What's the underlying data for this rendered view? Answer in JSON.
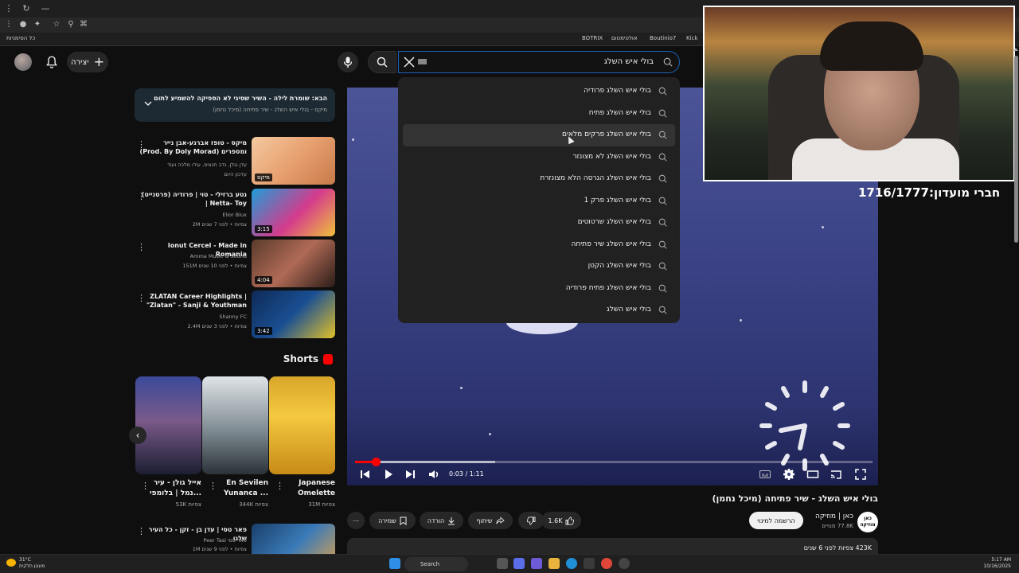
{
  "browser": {
    "bookmarks": [
      {
        "label": "Kick"
      },
      {
        "label": "Boutinio7"
      },
      {
        "label": "אולטימטום"
      },
      {
        "label": "BOTRIX"
      }
    ],
    "all_bookmarks": "כל הסימניות"
  },
  "header": {
    "create_label": "יצירה",
    "search_value": "בולי איש השלג"
  },
  "suggestions": [
    "בולי איש השלג פרודיה",
    "בולי איש השלג פתיח",
    "בולי איש השלג פרקים מלאים",
    "בולי איש השלג לא מצונזר",
    "בולי איש השלג הגרסה הלא מצונזרת",
    "בולי איש השלג פרק 1",
    "בולי איש השלג שרטוטים",
    "בולי איש השלג שיר פתיחה",
    "בולי איש השלג הקטן",
    "בולי איש השלג פתיח פרודיה",
    "בולי איש השלג"
  ],
  "player": {
    "time": "0:03 / 1:11",
    "progress_played": 0.04,
    "progress_buffered": 0.27
  },
  "video": {
    "title": "בולי איש השלג - שיר פתיחה (מיכל נחמן)",
    "channel": "כאן | מוזיקה",
    "subscribers": "77.8K מנויים",
    "channel_logo_text": "כאן מוזיקה",
    "subscribe": "הרשמה למינוי",
    "likes": "1.6K",
    "share": "שיתוף",
    "download": "הורדה",
    "save": "שמירה",
    "views_date": "423K צפיות לפני 6 שנים"
  },
  "overlay": {
    "members": "חברי מועדון:1716/1777"
  },
  "up_next": {
    "title": "הבא: שומרת לילה - השיר שסיגי לא הספיקה להשמיע לתום",
    "subtitle": "מיקס - בולי איש השלג - שיר פתיחה (מיכל נחמן)"
  },
  "recommendations": [
    {
      "title": "מיקס - טופז אברגע-אבן נייר (Prod. By Doly Morad) ומספרים",
      "meta1": "עדן גולן, נדב חנציס, עידו מלכה ועוד",
      "meta2": "עדכון היום",
      "badge": "מיקס"
    },
    {
      "title": "נטע ברזילי - טוי | פרודיה (פרטנייט) | Netta- Toy",
      "meta1": "Elior Blux",
      "meta2": "2M צפיות • לפני 7 שנים",
      "duration": "3:15"
    },
    {
      "title": "Ionut Cercel - Made in Romania",
      "meta1": "Amma Music & Sound",
      "meta2": "151M צפיות • לפני 10 שנים",
      "duration": "4:04"
    },
    {
      "title": "ZLATAN Career Highlights | \"Zlatan\" - Sanji & Youthman",
      "meta1": "Shanny FC",
      "meta2": "2.4M צפיות • לפני 3 שנים",
      "duration": "3:42"
    },
    {
      "title": "פאר טסי | עדן בן - זקן - כל העיר שלנו",
      "meta1": "Peer Tasi פאר טסי",
      "meta2": "1M צפיות • לפני 9 שנים"
    }
  ],
  "shorts": {
    "title": "Shorts",
    "items": [
      {
        "caption": "Japanese Omelette",
        "views": "31M צפיות"
      },
      {
        "caption": "En Sevilen Yunanca ...",
        "views": "344K צפיות"
      },
      {
        "caption": "אייל גולן - עיר נמל | בלומפי...",
        "views": "53K צפיות"
      }
    ]
  },
  "taskbar": {
    "temp": "31°C",
    "weather": "מעונן חלקית",
    "search": "Search",
    "time": "5:17 AM",
    "date": "10/16/2025"
  }
}
